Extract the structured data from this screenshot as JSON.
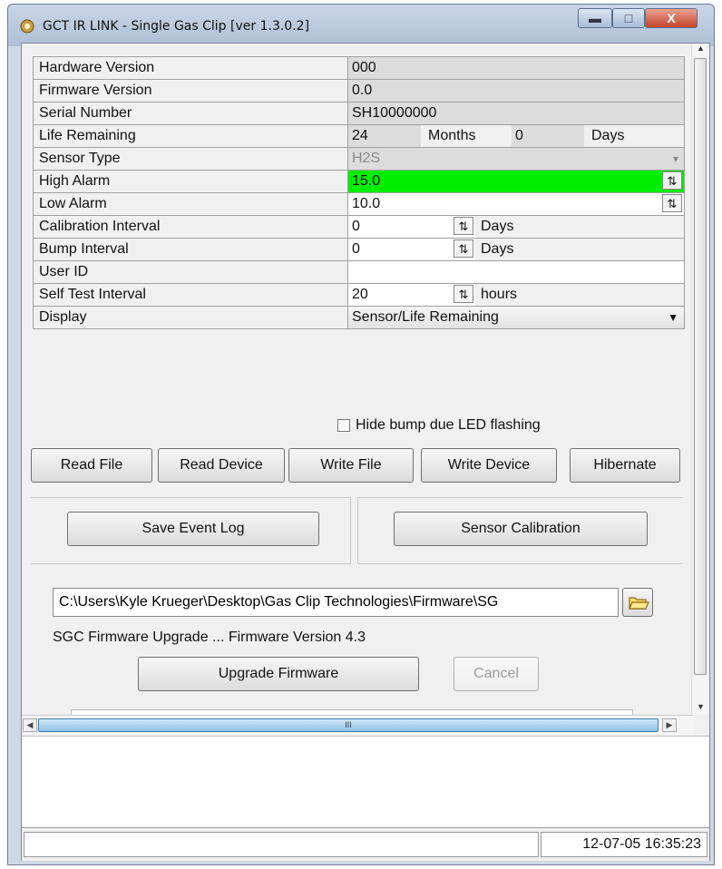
{
  "window": {
    "title": "GCT IR LINK - Single Gas Clip [ver 1.3.0.2]",
    "controls": {
      "minimize": "▬",
      "maximize": "□",
      "close": "X"
    }
  },
  "rows": [
    {
      "label": "Hardware Version",
      "value": "000"
    },
    {
      "label": "Firmware Version",
      "value": "0.0"
    },
    {
      "label": "Serial Number",
      "value": "SH10000000"
    },
    {
      "label": "Life Remaining",
      "months": "24",
      "months_label": "Months",
      "days": "0",
      "days_label": "Days"
    },
    {
      "label": "Sensor Type",
      "value": "H2S"
    },
    {
      "label": "High Alarm",
      "value": "15.0"
    },
    {
      "label": "Low Alarm",
      "value": "10.0"
    },
    {
      "label": "Calibration Interval",
      "value": "0",
      "unit": "Days"
    },
    {
      "label": "Bump Interval",
      "value": "0",
      "unit": "Days"
    },
    {
      "label": "User ID",
      "value": ""
    },
    {
      "label": "Self Test Interval",
      "value": "20",
      "unit": "hours"
    },
    {
      "label": "Display",
      "value": "Sensor/Life Remaining"
    }
  ],
  "checkbox": {
    "label": "Hide bump due LED flashing",
    "checked": false
  },
  "buttons": {
    "read_file": "Read File",
    "read_device": "Read Device",
    "write_file": "Write File",
    "write_device": "Write Device",
    "hibernate": "Hibernate",
    "save_event_log": "Save Event Log",
    "sensor_calibration": "Sensor Calibration",
    "upgrade_firmware": "Upgrade Firmware",
    "cancel": "Cancel"
  },
  "firmware": {
    "path": "C:\\Users\\Kyle Krueger\\Desktop\\Gas Clip Technologies\\Firmware\\SG",
    "status": "SGC Firmware Upgrade ... Firmware Version 4.3"
  },
  "scrollbar": {
    "thumb_grip": "III"
  },
  "status": {
    "datetime": "12-07-05 16:35:23"
  },
  "colors": {
    "alarm_high": "#00ee00",
    "readonly": "#dcdcdc"
  }
}
